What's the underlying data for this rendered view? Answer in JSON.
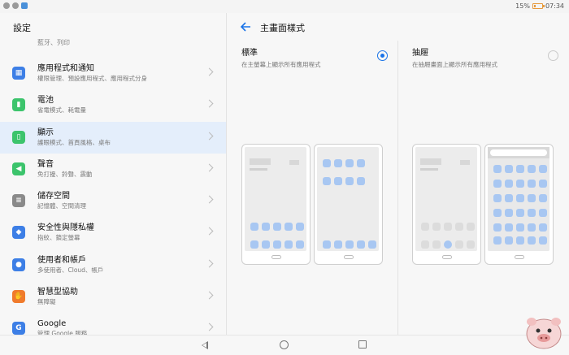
{
  "status": {
    "battery": "15%",
    "time": "07:34"
  },
  "left": {
    "title": "設定",
    "partial_row": "藍牙、列印",
    "items": [
      {
        "title": "應用程式和通知",
        "subtitle": "權限管理、預設應用程式、應用程式分身",
        "icon": "apps-icon",
        "color": "#3d7fe6"
      },
      {
        "title": "電池",
        "subtitle": "省電模式、耗電量",
        "icon": "battery-icon",
        "color": "#3cc46c"
      },
      {
        "title": "顯示",
        "subtitle": "護眼模式、首頁風格、桌布",
        "icon": "display-icon",
        "color": "#3cc46c"
      },
      {
        "title": "聲音",
        "subtitle": "免打擾、鈴聲、震動",
        "icon": "sound-icon",
        "color": "#3cc46c"
      },
      {
        "title": "儲存空間",
        "subtitle": "記憶體、空間清理",
        "icon": "storage-icon",
        "color": "#8a8a8a"
      },
      {
        "title": "安全性與隱私權",
        "subtitle": "指紋、鎖定螢幕",
        "icon": "shield-icon",
        "color": "#3d7fe6"
      },
      {
        "title": "使用者和帳戶",
        "subtitle": "多使用者、Cloud、帳戶",
        "icon": "user-icon",
        "color": "#3d7fe6"
      },
      {
        "title": "智慧型協助",
        "subtitle": "無障礙",
        "icon": "hand-icon",
        "color": "#f07b2c"
      },
      {
        "title": "Google",
        "subtitle": "管理 Google 服務",
        "icon": "google-icon",
        "color": "#3d7fe6"
      }
    ]
  },
  "right": {
    "title": "主畫面樣式",
    "options": [
      {
        "title": "標準",
        "subtitle": "在主螢幕上顯示所有應用程式",
        "selected": true
      },
      {
        "title": "抽屜",
        "subtitle": "在抽屜畫面上顯示所有應用程式",
        "selected": false
      }
    ]
  },
  "colors": {
    "accent": "#1a73e8",
    "selected_bg": "#e4eefb",
    "app_icon": "#a8c7f2"
  }
}
